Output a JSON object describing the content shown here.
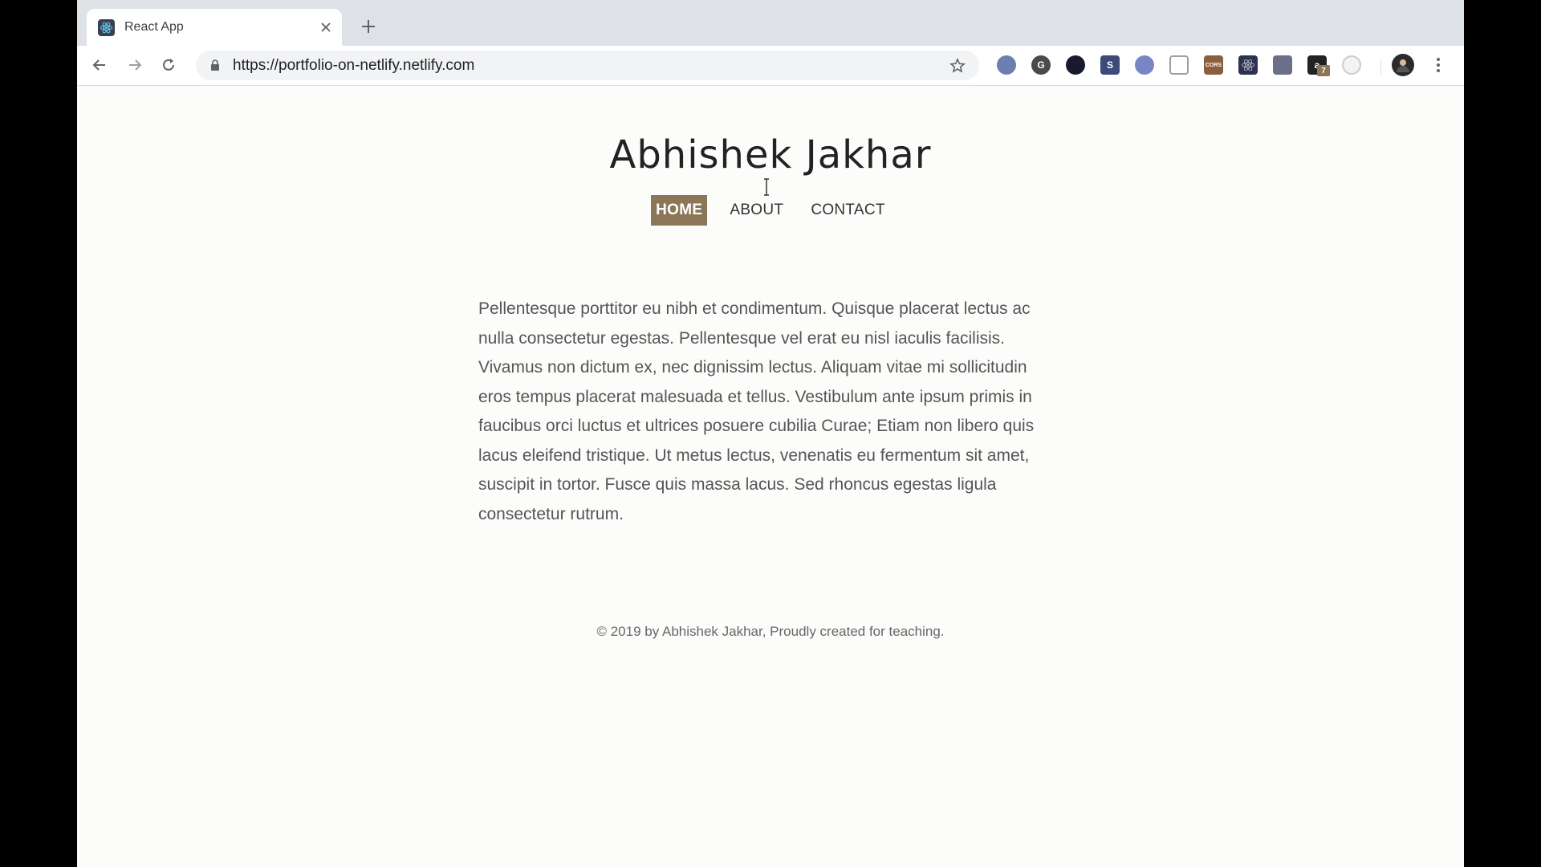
{
  "browser": {
    "tab_title": "React App",
    "url": "https://portfolio-on-netlify.netlify.com",
    "extensions": [
      {
        "name": "ext-1-icon",
        "color": "#6b7fb0"
      },
      {
        "name": "ext-grammarly-icon",
        "color": "#4a4a4a"
      },
      {
        "name": "ext-dark-icon",
        "color": "#1a1a2e"
      },
      {
        "name": "ext-s-icon",
        "color": "#3d4a7a"
      },
      {
        "name": "ext-globe-icon",
        "color": "#7a86c4"
      },
      {
        "name": "ext-shield-icon",
        "color": "#9aa0a6"
      },
      {
        "name": "ext-cors-icon",
        "color": "#8b5e3c"
      },
      {
        "name": "ext-react-icon",
        "color": "#2d3250"
      },
      {
        "name": "ext-film-icon",
        "color": "#6b6f8a"
      },
      {
        "name": "ext-amazon-icon",
        "color": "#222222"
      },
      {
        "name": "ext-circle-icon",
        "color": "#c8cbd0"
      }
    ],
    "amazon_badge": "7"
  },
  "site": {
    "title": "Abhishek Jakhar",
    "nav": [
      {
        "label": "HOME",
        "active": true
      },
      {
        "label": "ABOUT",
        "active": false
      },
      {
        "label": "CONTACT",
        "active": false
      }
    ],
    "paragraph": "Pellentesque porttitor eu nibh et condimentum. Quisque placerat lectus ac nulla consectetur egestas. Pellentesque vel erat eu nisl iaculis facilisis. Vivamus non dictum ex, nec dignissim lectus. Aliquam vitae mi sollicitudin eros tempus placerat malesuada et tellus. Vestibulum ante ipsum primis in faucibus orci luctus et ultrices posuere cubilia Curae; Etiam non libero quis lacus eleifend tristique. Ut metus lectus, venenatis eu fermentum sit amet, suscipit in tortor. Fusce quis massa lacus. Sed rhoncus egestas ligula consectetur rutrum.",
    "footer": "© 2019 by Abhishek Jakhar, Proudly created for teaching."
  },
  "colors": {
    "accent": "#8b7658",
    "page_bg": "#fcfcfb",
    "text": "#555555"
  }
}
